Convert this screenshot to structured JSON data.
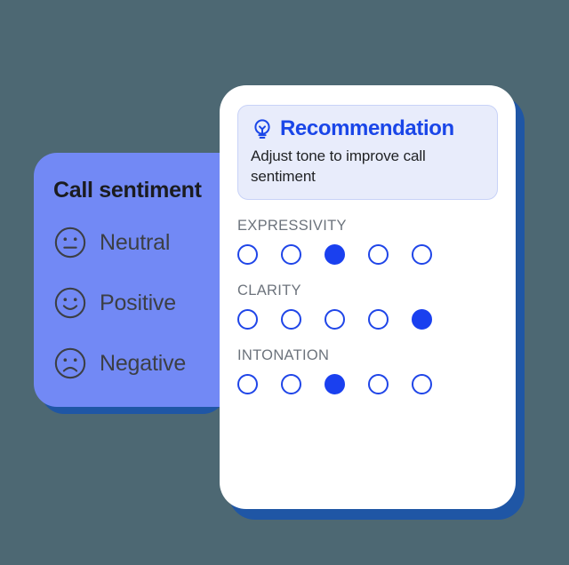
{
  "theme": {
    "page_background": "#4d6873",
    "sentiment_card_color": "#7289f5",
    "card_shadow_color": "#1f56a5",
    "accent_blue": "#1a40ef",
    "recommendation_bg": "#e8ecfb",
    "recommendation_border": "#c8d2f7",
    "label_gray": "#6c737c"
  },
  "sentiment_card": {
    "title": "Call sentiment",
    "items": [
      {
        "icon": "neutral-face-icon",
        "label": "Neutral"
      },
      {
        "icon": "positive-face-icon",
        "label": "Positive"
      },
      {
        "icon": "negative-face-icon",
        "label": "Negative"
      }
    ]
  },
  "recommendation": {
    "icon": "lightbulb-icon",
    "title": "Recommendation",
    "body": "Adjust tone to improve call sentiment"
  },
  "metrics": [
    {
      "label": "EXPRESSIVITY",
      "total": 5,
      "selected": 3
    },
    {
      "label": "CLARITY",
      "total": 5,
      "selected": 5
    },
    {
      "label": "INTONATION",
      "total": 5,
      "selected": 3
    }
  ]
}
